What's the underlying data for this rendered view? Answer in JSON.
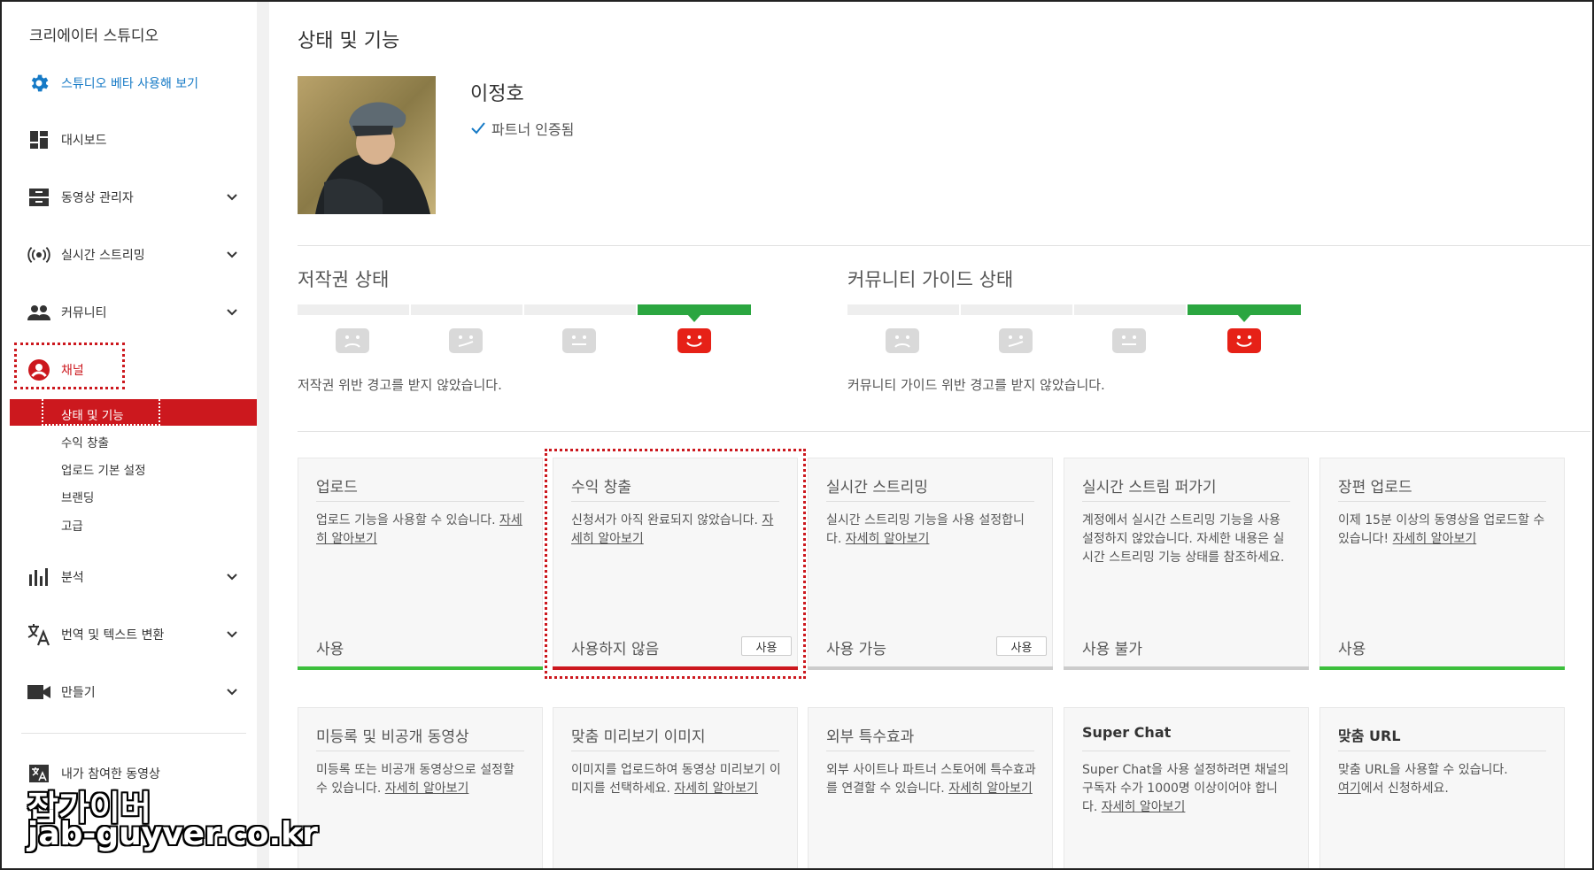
{
  "sidebar": {
    "brand": "크리에이터 스튜디오",
    "items": [
      {
        "label": "스튜디오 베타 사용해 보기",
        "icon": "gear-icon"
      },
      {
        "label": "대시보드",
        "icon": "dashboard-icon"
      },
      {
        "label": "동영상 관리자",
        "icon": "video-manager-icon"
      },
      {
        "label": "실시간 스트리밍",
        "icon": "live-stream-icon"
      },
      {
        "label": "커뮤니티",
        "icon": "community-icon"
      },
      {
        "label": "채널",
        "icon": "channel-icon"
      }
    ],
    "channel_sub": [
      "상태 및 기능",
      "수익 창출",
      "업로드 기본 설정",
      "브랜딩",
      "고급"
    ],
    "items2": [
      {
        "label": "분석",
        "icon": "analytics-icon"
      },
      {
        "label": "번역 및 텍스트 변환",
        "icon": "translate-icon"
      },
      {
        "label": "만들기",
        "icon": "create-icon"
      }
    ],
    "contrib": {
      "label": "내가 참여한 동영상",
      "icon": "translate-icon"
    }
  },
  "main": {
    "title": "상태 및 기능",
    "user_name": "이정호",
    "verified": "파트너 인증됨",
    "copyright": {
      "title": "저작권 상태",
      "text": "저작권 위반 경고를 받지 않았습니다."
    },
    "community": {
      "title": "커뮤니티 가이드 상태",
      "text": "커뮤니티 가이드 위반 경고를 받지 않았습니다."
    },
    "cards_row1": [
      {
        "title": "업로드",
        "desc": "업로드 기능을 사용할 수 있습니다.",
        "link": "자세히 알아보기",
        "status": "사용",
        "button": ""
      },
      {
        "title": "수익 창출",
        "desc": "신청서가 아직 완료되지 않았습니다.",
        "link": "자세히 알아보기",
        "status": "사용하지 않음",
        "button": "사용"
      },
      {
        "title": "실시간 스트리밍",
        "desc": "실시간 스트리밍 기능을 사용 설정합니다.",
        "link": "자세히 알아보기",
        "status": "사용 가능",
        "button": "사용"
      },
      {
        "title": "실시간 스트림 퍼가기",
        "desc": "계정에서 실시간 스트리밍 기능을 사용 설정하지 않았습니다. 자세한 내용은 실시간 스트리밍 기능 상태를 참조하세요.",
        "link": "",
        "status": "사용 불가",
        "button": ""
      },
      {
        "title": "장편 업로드",
        "desc": "이제 15분 이상의 동영상을 업로드할 수 있습니다!",
        "link": "자세히 알아보기",
        "status": "사용",
        "button": ""
      }
    ],
    "cards_row2": [
      {
        "title": "미등록 및 비공개 동영상",
        "desc": "미등록 또는 비공개 동영상으로 설정할 수 있습니다.",
        "link": "자세히 알아보기",
        "suffix": ""
      },
      {
        "title": "맞춤 미리보기 이미지",
        "desc": "이미지를 업로드하여 동영상 미리보기 이미지를 선택하세요.",
        "link": "자세히 알아보기",
        "suffix": ""
      },
      {
        "title": "외부 특수효과",
        "desc": "외부 사이트나 파트너 스토어에 특수효과를 연결할 수 있습니다.",
        "link": "자세히 알아보기",
        "suffix": ""
      },
      {
        "title": "Super Chat",
        "desc": "Super Chat을 사용 설정하려면 채널의 구독자 수가 1000명 이상이어야 합니다.",
        "link": "자세히 알아보기",
        "suffix": ""
      },
      {
        "title": "맞춤 URL",
        "desc": "맞춤 URL을 사용할 수 있습니다.",
        "link": "여기",
        "suffix": "에서 신청하세요."
      }
    ]
  },
  "watermark": {
    "line1": "잡가이버",
    "line2": "jab-guyver.co.kr"
  },
  "colors": {
    "accent": "#cc181e",
    "link": "#167ac6",
    "green": "#2ba640"
  }
}
